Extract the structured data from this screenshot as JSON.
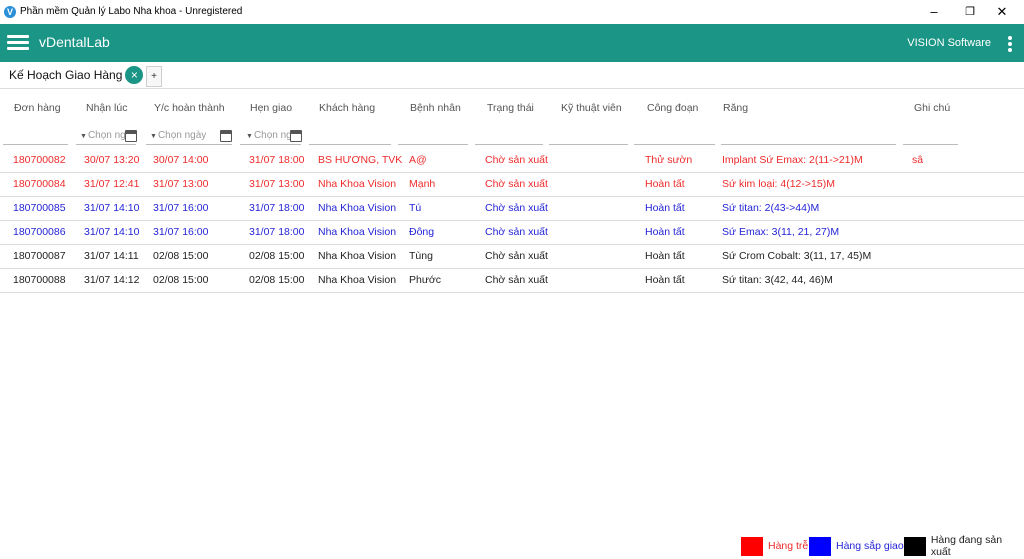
{
  "window": {
    "title": "Phần mềm Quản lý Labo Nha khoa - Unregistered",
    "minimize": "–",
    "maximize": "❐",
    "close": "✕"
  },
  "appbar": {
    "name": "vDentalLab",
    "vendor": "VISION Software"
  },
  "tabs": [
    {
      "label": "Kế Hoạch Giao Hàng",
      "close_icon": "×"
    }
  ],
  "tab_add": "+",
  "table": {
    "columns": [
      "Đơn hàng",
      "Nhận lúc",
      "Y/c hoàn thành",
      "Hẹn giao",
      "Khách hàng",
      "Bệnh nhân",
      "Trạng thái",
      "Kỹ thuật viên",
      "Công đoạn",
      "Răng",
      "Ghi chú"
    ],
    "filters": {
      "received_at": "Chọn ng",
      "required": "Chọn ngày",
      "delivery": "Chọn ng"
    },
    "rows": [
      {
        "status_class": "late",
        "order": "180700082",
        "received": "30/07 13:20",
        "required": "30/07 14:00",
        "delivery": "31/07 18:00",
        "customer": "BS HƯƠNG, TVK",
        "patient": "A@",
        "state": "Chờ sản xuất",
        "technician": "",
        "stage": "Thử sườn",
        "teeth": "Implant Sứ Emax: 2(11->21)M",
        "note": "sâ"
      },
      {
        "status_class": "late",
        "order": "180700084",
        "received": "31/07 12:41",
        "required": "31/07 13:00",
        "delivery": "31/07 13:00",
        "customer": "Nha Khoa Vision",
        "patient": "Mạnh",
        "state": "Chờ sản xuất",
        "technician": "",
        "stage": "Hoàn tất",
        "teeth": "Sứ kim loại: 4(12->15)M",
        "note": ""
      },
      {
        "status_class": "soon",
        "order": "180700085",
        "received": "31/07 14:10",
        "required": "31/07 16:00",
        "delivery": "31/07 18:00",
        "customer": "Nha Khoa Vision",
        "patient": "Tú",
        "state": "Chờ sản xuất",
        "technician": "",
        "stage": "Hoàn tất",
        "teeth": "Sứ titan: 2(43->44)M",
        "note": ""
      },
      {
        "status_class": "soon",
        "order": "180700086",
        "received": "31/07 14:10",
        "required": "31/07 16:00",
        "delivery": "31/07 18:00",
        "customer": "Nha Khoa Vision",
        "patient": "Đông",
        "state": "Chờ sản xuất",
        "technician": "",
        "stage": "Hoàn tất",
        "teeth": "Sứ Emax: 3(11, 21, 27)M",
        "note": ""
      },
      {
        "status_class": "prod",
        "order": "180700087",
        "received": "31/07 14:11",
        "required": "02/08 15:00",
        "delivery": "02/08 15:00",
        "customer": "Nha Khoa Vision",
        "patient": "Tùng",
        "state": "Chờ sản xuất",
        "technician": "",
        "stage": "Hoàn tất",
        "teeth": "Sứ Crom Cobalt: 3(11, 17, 45)M",
        "note": ""
      },
      {
        "status_class": "prod",
        "order": "180700088",
        "received": "31/07 14:12",
        "required": "02/08 15:00",
        "delivery": "02/08 15:00",
        "customer": "Nha Khoa Vision",
        "patient": "Phước",
        "state": "Chờ sản xuất",
        "technician": "",
        "stage": "Hoàn tất",
        "teeth": "Sứ titan: 3(42, 44, 46)M",
        "note": ""
      }
    ]
  },
  "legend": [
    {
      "label": "Hàng trễ",
      "color": "#ff0000",
      "text_color": "#ee2b2b"
    },
    {
      "label": "Hàng sắp giao",
      "color": "#0000ff",
      "text_color": "#2424d6"
    },
    {
      "label": "Hàng đang sản xuất",
      "color": "#000000",
      "text_color": "#222222"
    }
  ],
  "colors": {
    "primary": "#1b9585",
    "late": "#ee2b2b",
    "soon": "#2424d6",
    "in_production": "#222222"
  }
}
